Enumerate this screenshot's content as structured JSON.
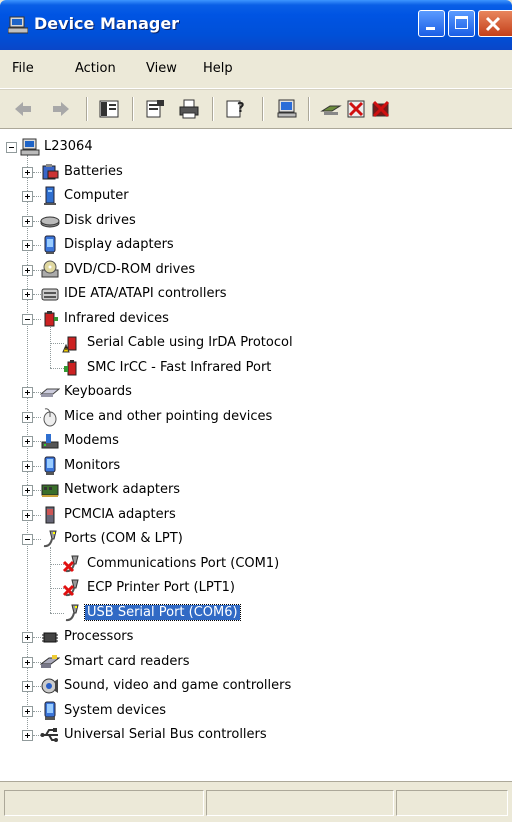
{
  "window": {
    "title": "Device Manager",
    "icon": "computer-monitor-icon"
  },
  "menu": [
    "File",
    "Action",
    "View",
    "Help"
  ],
  "toolbar": {
    "buttons": [
      "back-arrow-icon",
      "forward-arrow-icon",
      "console-tree-icon",
      "properties-icon",
      "print-icon",
      "help-icon",
      "scan-hardware-icon",
      "update-driver-icon",
      "disable-device-icon",
      "uninstall-device-icon"
    ]
  },
  "tree": {
    "root": "L23064",
    "categories": [
      {
        "label": "Batteries",
        "icon": "battery-icon",
        "expanded": false
      },
      {
        "label": "Computer",
        "icon": "computer-icon",
        "expanded": false
      },
      {
        "label": "Disk drives",
        "icon": "disk-drive-icon",
        "expanded": false
      },
      {
        "label": "Display adapters",
        "icon": "display-adapter-icon",
        "expanded": false
      },
      {
        "label": "DVD/CD-ROM drives",
        "icon": "cdrom-icon",
        "expanded": false
      },
      {
        "label": "IDE ATA/ATAPI controllers",
        "icon": "ide-controller-icon",
        "expanded": false
      },
      {
        "label": "Infrared devices",
        "icon": "infrared-icon",
        "expanded": true,
        "children": [
          {
            "label": "Serial Cable using IrDA Protocol",
            "icon": "warning-device-icon"
          },
          {
            "label": "SMC IrCC - Fast Infrared Port",
            "icon": "infrared-port-icon"
          }
        ]
      },
      {
        "label": "Keyboards",
        "icon": "keyboard-icon",
        "expanded": false
      },
      {
        "label": "Mice and other pointing devices",
        "icon": "mouse-icon",
        "expanded": false
      },
      {
        "label": "Modems",
        "icon": "modem-icon",
        "expanded": false
      },
      {
        "label": "Monitors",
        "icon": "monitor-icon",
        "expanded": false
      },
      {
        "label": "Network adapters",
        "icon": "network-adapter-icon",
        "expanded": false
      },
      {
        "label": "PCMCIA adapters",
        "icon": "pcmcia-icon",
        "expanded": false
      },
      {
        "label": "Ports (COM & LPT)",
        "icon": "port-icon",
        "expanded": true,
        "children": [
          {
            "label": "Communications Port (COM1)",
            "icon": "disabled-port-icon"
          },
          {
            "label": "ECP Printer Port (LPT1)",
            "icon": "disabled-port-icon"
          },
          {
            "label": "USB Serial Port (COM6)",
            "icon": "port-icon",
            "selected": true
          }
        ]
      },
      {
        "label": "Processors",
        "icon": "processor-icon",
        "expanded": false
      },
      {
        "label": "Smart card readers",
        "icon": "smart-card-icon",
        "expanded": false
      },
      {
        "label": "Sound, video and game controllers",
        "icon": "sound-icon",
        "expanded": false
      },
      {
        "label": "System devices",
        "icon": "system-device-icon",
        "expanded": false
      },
      {
        "label": "Universal Serial Bus controllers",
        "icon": "usb-icon",
        "expanded": false
      }
    ]
  }
}
